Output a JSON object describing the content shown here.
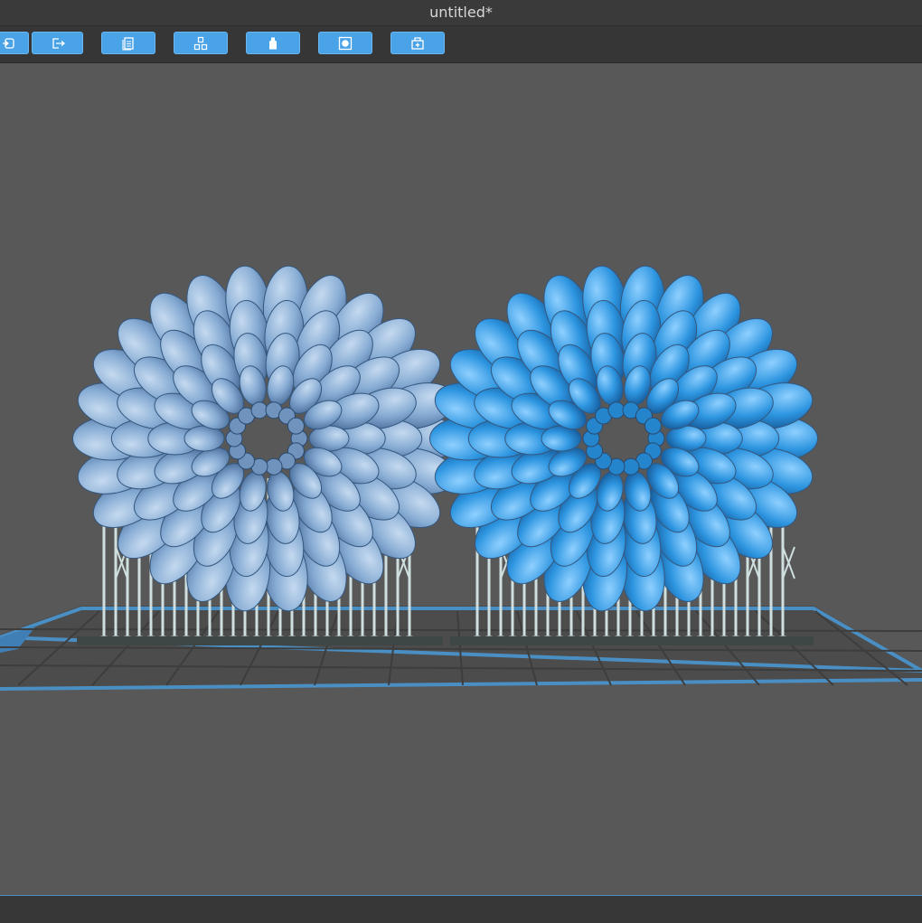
{
  "window": {
    "title": "untitled*"
  },
  "toolbar": {
    "buttons": [
      {
        "name": "import-icon"
      },
      {
        "name": "export-icon"
      },
      {
        "name": "document-list-icon"
      },
      {
        "name": "arrange-models-icon"
      },
      {
        "name": "resin-bottle-icon"
      },
      {
        "name": "slice-preview-icon"
      },
      {
        "name": "add-printer-icon"
      }
    ]
  },
  "viewport": {
    "models": [
      {
        "name": "flower-model-left",
        "color": "#7ea6d0",
        "selected": false
      },
      {
        "name": "flower-model-right",
        "color": "#2e95de",
        "selected": true
      }
    ],
    "build_plate_color": "#4a8fc4"
  },
  "colors": {
    "accent": "#4aa3e6",
    "background": "#585858"
  }
}
